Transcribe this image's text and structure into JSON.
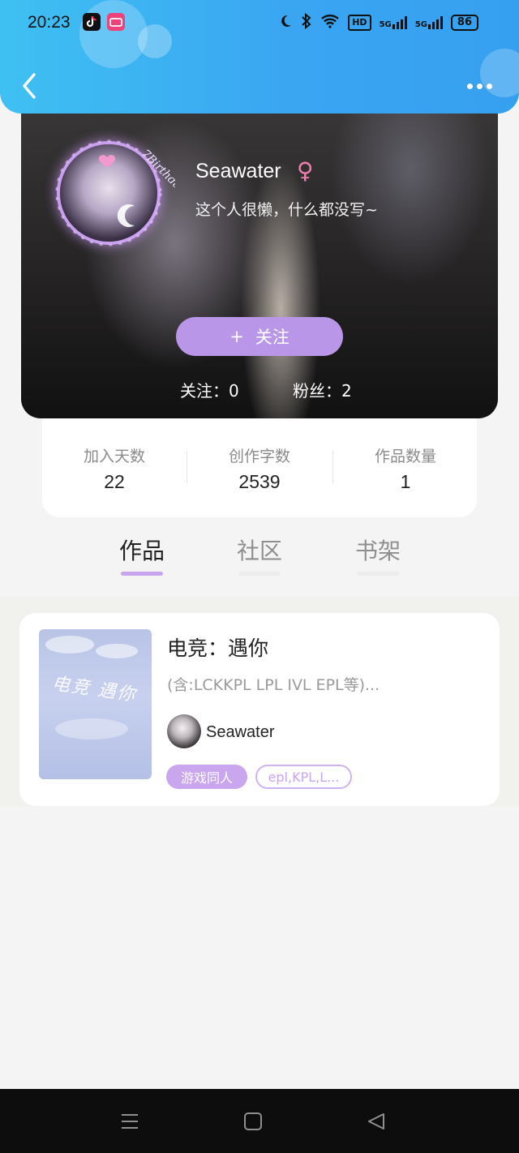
{
  "status_bar": {
    "time": "20:23",
    "battery": "86",
    "network_5g_a": "5G",
    "network_5g_b": "5G",
    "hd_label": "HD"
  },
  "header": {
    "back_icon": "chevron-left-icon",
    "more_icon": "more-dots-icon"
  },
  "profile": {
    "username": "Seawater",
    "gender_symbol": "♀",
    "bio": "这个人很懒，什么都没写~",
    "avatar_caption": "7Birthday",
    "follow_button": "关注",
    "follow_plus": "+",
    "following_label": "关注：0",
    "fans_label": "粉丝：2"
  },
  "stats": [
    {
      "label": "加入天数",
      "value": "22"
    },
    {
      "label": "创作字数",
      "value": "2539"
    },
    {
      "label": "作品数量",
      "value": "1"
    }
  ],
  "tabs": [
    {
      "label": "作品",
      "active": true
    },
    {
      "label": "社区",
      "active": false
    },
    {
      "label": "书架",
      "active": false
    }
  ],
  "works": [
    {
      "title": "电竞：遇你",
      "description": "(含:LCKKPL   LPL   IVL  EPL等)...",
      "author": "Seawater",
      "cover_text": "电竞 遇你",
      "tags": [
        "游戏同人",
        "epl,KPL,L..."
      ]
    }
  ],
  "colors": {
    "header_blue": "#3aa6f2",
    "accent_purple": "#b996e8",
    "gender_pink": "#f07fb0"
  }
}
